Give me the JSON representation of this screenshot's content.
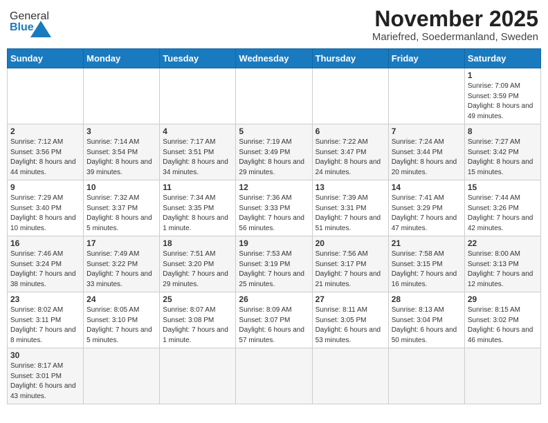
{
  "header": {
    "logo_general": "General",
    "logo_blue": "Blue",
    "month_year": "November 2025",
    "location": "Mariefred, Soedermanland, Sweden"
  },
  "days_of_week": [
    "Sunday",
    "Monday",
    "Tuesday",
    "Wednesday",
    "Thursday",
    "Friday",
    "Saturday"
  ],
  "weeks": [
    [
      {
        "day": "",
        "info": ""
      },
      {
        "day": "",
        "info": ""
      },
      {
        "day": "",
        "info": ""
      },
      {
        "day": "",
        "info": ""
      },
      {
        "day": "",
        "info": ""
      },
      {
        "day": "",
        "info": ""
      },
      {
        "day": "1",
        "info": "Sunrise: 7:09 AM\nSunset: 3:59 PM\nDaylight: 8 hours\nand 49 minutes."
      }
    ],
    [
      {
        "day": "2",
        "info": "Sunrise: 7:12 AM\nSunset: 3:56 PM\nDaylight: 8 hours\nand 44 minutes."
      },
      {
        "day": "3",
        "info": "Sunrise: 7:14 AM\nSunset: 3:54 PM\nDaylight: 8 hours\nand 39 minutes."
      },
      {
        "day": "4",
        "info": "Sunrise: 7:17 AM\nSunset: 3:51 PM\nDaylight: 8 hours\nand 34 minutes."
      },
      {
        "day": "5",
        "info": "Sunrise: 7:19 AM\nSunset: 3:49 PM\nDaylight: 8 hours\nand 29 minutes."
      },
      {
        "day": "6",
        "info": "Sunrise: 7:22 AM\nSunset: 3:47 PM\nDaylight: 8 hours\nand 24 minutes."
      },
      {
        "day": "7",
        "info": "Sunrise: 7:24 AM\nSunset: 3:44 PM\nDaylight: 8 hours\nand 20 minutes."
      },
      {
        "day": "8",
        "info": "Sunrise: 7:27 AM\nSunset: 3:42 PM\nDaylight: 8 hours\nand 15 minutes."
      }
    ],
    [
      {
        "day": "9",
        "info": "Sunrise: 7:29 AM\nSunset: 3:40 PM\nDaylight: 8 hours\nand 10 minutes."
      },
      {
        "day": "10",
        "info": "Sunrise: 7:32 AM\nSunset: 3:37 PM\nDaylight: 8 hours\nand 5 minutes."
      },
      {
        "day": "11",
        "info": "Sunrise: 7:34 AM\nSunset: 3:35 PM\nDaylight: 8 hours\nand 1 minute."
      },
      {
        "day": "12",
        "info": "Sunrise: 7:36 AM\nSunset: 3:33 PM\nDaylight: 7 hours\nand 56 minutes."
      },
      {
        "day": "13",
        "info": "Sunrise: 7:39 AM\nSunset: 3:31 PM\nDaylight: 7 hours\nand 51 minutes."
      },
      {
        "day": "14",
        "info": "Sunrise: 7:41 AM\nSunset: 3:29 PM\nDaylight: 7 hours\nand 47 minutes."
      },
      {
        "day": "15",
        "info": "Sunrise: 7:44 AM\nSunset: 3:26 PM\nDaylight: 7 hours\nand 42 minutes."
      }
    ],
    [
      {
        "day": "16",
        "info": "Sunrise: 7:46 AM\nSunset: 3:24 PM\nDaylight: 7 hours\nand 38 minutes."
      },
      {
        "day": "17",
        "info": "Sunrise: 7:49 AM\nSunset: 3:22 PM\nDaylight: 7 hours\nand 33 minutes."
      },
      {
        "day": "18",
        "info": "Sunrise: 7:51 AM\nSunset: 3:20 PM\nDaylight: 7 hours\nand 29 minutes."
      },
      {
        "day": "19",
        "info": "Sunrise: 7:53 AM\nSunset: 3:19 PM\nDaylight: 7 hours\nand 25 minutes."
      },
      {
        "day": "20",
        "info": "Sunrise: 7:56 AM\nSunset: 3:17 PM\nDaylight: 7 hours\nand 21 minutes."
      },
      {
        "day": "21",
        "info": "Sunrise: 7:58 AM\nSunset: 3:15 PM\nDaylight: 7 hours\nand 16 minutes."
      },
      {
        "day": "22",
        "info": "Sunrise: 8:00 AM\nSunset: 3:13 PM\nDaylight: 7 hours\nand 12 minutes."
      }
    ],
    [
      {
        "day": "23",
        "info": "Sunrise: 8:02 AM\nSunset: 3:11 PM\nDaylight: 7 hours\nand 8 minutes."
      },
      {
        "day": "24",
        "info": "Sunrise: 8:05 AM\nSunset: 3:10 PM\nDaylight: 7 hours\nand 5 minutes."
      },
      {
        "day": "25",
        "info": "Sunrise: 8:07 AM\nSunset: 3:08 PM\nDaylight: 7 hours\nand 1 minute."
      },
      {
        "day": "26",
        "info": "Sunrise: 8:09 AM\nSunset: 3:07 PM\nDaylight: 6 hours\nand 57 minutes."
      },
      {
        "day": "27",
        "info": "Sunrise: 8:11 AM\nSunset: 3:05 PM\nDaylight: 6 hours\nand 53 minutes."
      },
      {
        "day": "28",
        "info": "Sunrise: 8:13 AM\nSunset: 3:04 PM\nDaylight: 6 hours\nand 50 minutes."
      },
      {
        "day": "29",
        "info": "Sunrise: 8:15 AM\nSunset: 3:02 PM\nDaylight: 6 hours\nand 46 minutes."
      }
    ],
    [
      {
        "day": "30",
        "info": "Sunrise: 8:17 AM\nSunset: 3:01 PM\nDaylight: 6 hours\nand 43 minutes."
      },
      {
        "day": "",
        "info": ""
      },
      {
        "day": "",
        "info": ""
      },
      {
        "day": "",
        "info": ""
      },
      {
        "day": "",
        "info": ""
      },
      {
        "day": "",
        "info": ""
      },
      {
        "day": "",
        "info": ""
      }
    ]
  ]
}
